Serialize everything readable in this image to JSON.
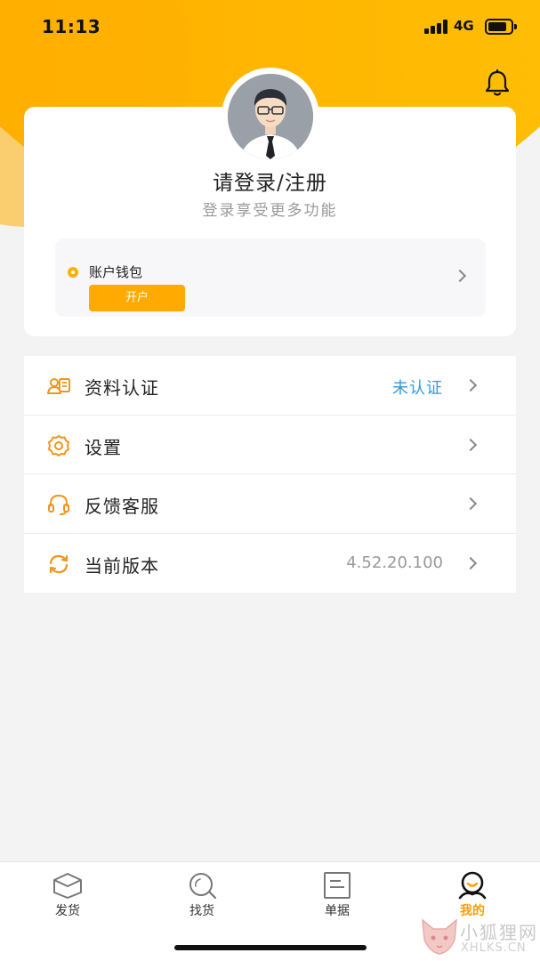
{
  "status_bar": {
    "time": "11:13",
    "network": "4G"
  },
  "profile": {
    "title": "请登录/注册",
    "subtitle": "登录享受更多功能",
    "wallet": {
      "label": "账户钱包",
      "button_label": "开户"
    }
  },
  "menu": {
    "items": [
      {
        "label": "资料认证",
        "value": "未认证",
        "icon": "id-card-icon"
      },
      {
        "label": "设置",
        "value": "",
        "icon": "gear-icon"
      },
      {
        "label": "反馈客服",
        "value": "",
        "icon": "headset-icon"
      },
      {
        "label": "当前版本",
        "value": "4.52.20.100",
        "icon": "refresh-icon"
      }
    ]
  },
  "tabbar": {
    "tabs": [
      {
        "label": "发货",
        "icon": "box-icon",
        "active": false
      },
      {
        "label": "找货",
        "icon": "search-chat-icon",
        "active": false
      },
      {
        "label": "单据",
        "icon": "document-icon",
        "active": false
      },
      {
        "label": "我的",
        "icon": "user-icon",
        "active": true
      }
    ]
  },
  "watermark": {
    "cn": "小狐狸网",
    "en": "XHLKS.CN"
  },
  "colors": {
    "accent": "#ffa800",
    "link": "#2f9ae0",
    "active_tab": "#ff9d00"
  }
}
